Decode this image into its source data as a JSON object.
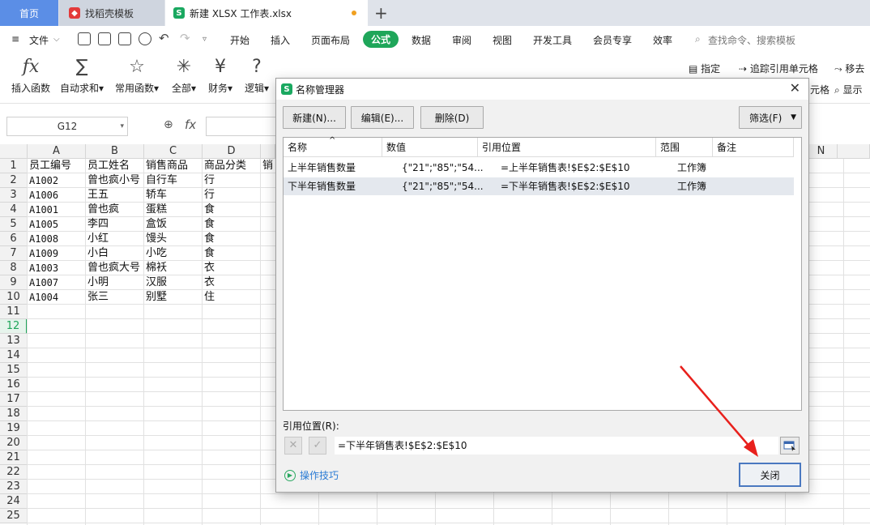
{
  "tabs": {
    "home": "首页",
    "template": "找稻壳模板",
    "document": "新建 XLSX 工作表.xlsx",
    "add": "+"
  },
  "menu": {
    "file": "文件",
    "items": [
      "开始",
      "插入",
      "页面布局",
      "公式",
      "数据",
      "审阅",
      "视图",
      "开发工具",
      "会员专享",
      "效率"
    ],
    "active": "公式",
    "search": "查找命令、搜索模板"
  },
  "ribbon": {
    "buttons": [
      {
        "label": "插入函数",
        "glyph": "fx"
      },
      {
        "label": "自动求和",
        "glyph": "∑"
      },
      {
        "label": "常用函数",
        "glyph": "☆"
      },
      {
        "label": "全部",
        "glyph": "✳"
      },
      {
        "label": "财务",
        "glyph": "¥"
      },
      {
        "label": "逻辑",
        "glyph": "?"
      }
    ],
    "right_items": [
      "指定",
      "追踪引用单元格",
      "移去",
      "元格",
      "显示"
    ]
  },
  "formula_bar": {
    "cell_ref": "G12",
    "fx": "fx"
  },
  "sheet": {
    "columns": [
      "A",
      "B",
      "C",
      "D",
      "N"
    ],
    "rows": [
      "1",
      "2",
      "3",
      "4",
      "5",
      "6",
      "7",
      "8",
      "9",
      "10",
      "11",
      "12",
      "13",
      "14",
      "15",
      "16",
      "17",
      "18",
      "19",
      "20",
      "21",
      "22",
      "23",
      "24",
      "25"
    ],
    "selected_row": "12",
    "header_e_partial": "销",
    "data": [
      [
        "员工编号",
        "员工姓名",
        "销售商品",
        "商品分类"
      ],
      [
        "A1002",
        "曾也疯小号",
        "自行车",
        "行"
      ],
      [
        "A1006",
        "王五",
        "轿车",
        "行"
      ],
      [
        "A1001",
        "曾也疯",
        "蛋糕",
        "食"
      ],
      [
        "A1005",
        "李四",
        "盒饭",
        "食"
      ],
      [
        "A1008",
        "小红",
        "馒头",
        "食"
      ],
      [
        "A1009",
        "小白",
        "小吃",
        "食"
      ],
      [
        "A1003",
        "曾也疯大号",
        "棉袄",
        "衣"
      ],
      [
        "A1007",
        "小明",
        "汉服",
        "衣"
      ],
      [
        "A1004",
        "张三",
        "别墅",
        "住"
      ]
    ]
  },
  "dialog": {
    "title": "名称管理器",
    "new_btn": "新建(N)...",
    "edit_btn": "编辑(E)...",
    "delete_btn": "删除(D)",
    "filter_btn": "筛选(F)",
    "headers": [
      "名称",
      "数值",
      "引用位置",
      "范围",
      "备注"
    ],
    "rows": [
      {
        "name": "上半年销售数量",
        "value": "{\"21\";\"85\";\"54...",
        "ref": "=上半年销售表!$E$2:$E$10",
        "scope": "工作簿",
        "note": ""
      },
      {
        "name": "下半年销售数量",
        "value": "{\"21\";\"85\";\"54...",
        "ref": "=下半年销售表!$E$2:$E$10",
        "scope": "工作簿",
        "note": ""
      }
    ],
    "ref_label": "引用位置(R):",
    "ref_value": "=下半年销售表!$E$2:$E$10",
    "tips": "操作技巧",
    "close": "关闭"
  }
}
